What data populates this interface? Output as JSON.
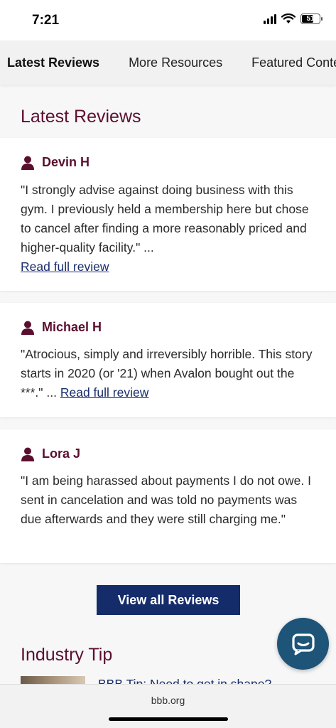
{
  "status": {
    "time": "7:21",
    "battery": "51"
  },
  "tabs": [
    {
      "label": "Latest Reviews",
      "active": true
    },
    {
      "label": "More Resources",
      "active": false
    },
    {
      "label": "Featured Conte",
      "active": false
    }
  ],
  "latest_reviews": {
    "title": "Latest Reviews",
    "reviews": [
      {
        "name": "Devin H",
        "text": "\"I strongly advise against doing business with this gym. I previously held a membership here but chose to cancel after finding a more reasonably priced and higher-quality facility.\" ...",
        "link": "Read full review"
      },
      {
        "name": "Michael H",
        "text": "\"Atrocious, simply and irreversibly horrible. This story starts in 2020 (or '21) when Avalon bought out the ***.\" ...",
        "link": "Read full review"
      },
      {
        "name": "Lora J",
        "text": "\"I am being harassed about payments I do not owe. I sent in cancelation and was told no payments was due afterwards and they were still charging me.\"",
        "link": ""
      }
    ],
    "view_all_label": "View all Reviews"
  },
  "industry_tip": {
    "title": "Industry Tip",
    "link": "BBB Tip: Need to get in shape?"
  },
  "browser": {
    "url": "bbb.org"
  },
  "colors": {
    "brand": "#5b0f2e",
    "link": "#1a2d6b",
    "button": "#152c6b",
    "chat": "#1e5478"
  }
}
